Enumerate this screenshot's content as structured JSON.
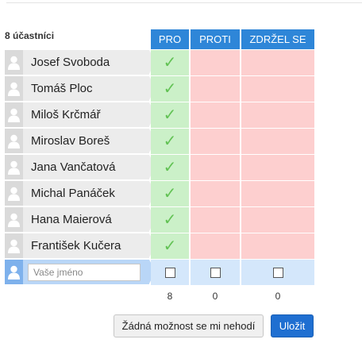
{
  "poll": {
    "participants_label": "8 účastníci",
    "columns": [
      "PRO",
      "PROTI",
      "ZDRŽEL SE"
    ],
    "participants": [
      {
        "name": "Josef Svoboda",
        "vote": "PRO"
      },
      {
        "name": "Tomáš Ploc",
        "vote": "PRO"
      },
      {
        "name": "Miloš Krčmář",
        "vote": "PRO"
      },
      {
        "name": "Miroslav Boreš",
        "vote": "PRO"
      },
      {
        "name": "Jana Vančatová",
        "vote": "PRO"
      },
      {
        "name": "Michal Panáček",
        "vote": "PRO"
      },
      {
        "name": "Hana Maierová",
        "vote": "PRO"
      },
      {
        "name": "František Kučera",
        "vote": "PRO"
      }
    ],
    "input_placeholder": "Vaše jméno",
    "totals": [
      "8",
      "0",
      "0"
    ],
    "check_symbol": "✓"
  },
  "actions": {
    "none_label": "Žádná možnost se mi nehodí",
    "save_label": "Uložit"
  },
  "colors": {
    "header": "#2e86d8",
    "yes_cell": "#cbf0c8",
    "no_cell": "#fdcfcf",
    "checkmark": "#62c254",
    "input_row": "#b9d6f7",
    "save_button": "#1f6fd1"
  }
}
